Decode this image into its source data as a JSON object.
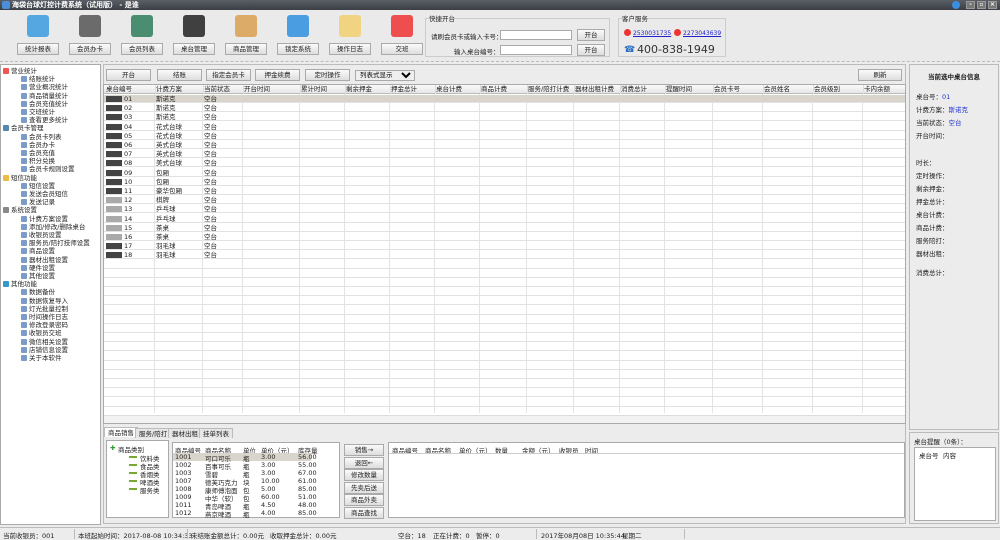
{
  "window": {
    "title": "海袋台球灯控计费系统（试用版） - 是谁"
  },
  "toolbar": {
    "items": [
      "统计报表",
      "会员办卡",
      "会员列表",
      "桌台管理",
      "商品管理",
      "锁定系统",
      "操作日志",
      "交班"
    ]
  },
  "quick_open": {
    "title": "快捷开台",
    "card_label": "请刷会员卡或输入卡号：",
    "card_value": "",
    "table_label": "输入桌台编号：",
    "table_value": "",
    "open_btn": "开台"
  },
  "service": {
    "title": "客户服务",
    "qq1": "2530031735",
    "qq2": "2273043639",
    "phone": "400-838-1949"
  },
  "sidebar": [
    {
      "label": "营业统计",
      "children": [
        "结账统计",
        "营业概况统计",
        "商品销量统计",
        "会员充值统计",
        "交班统计",
        "查看更多统计"
      ]
    },
    {
      "label": "会员卡管理",
      "children": [
        "会员卡列表",
        "会员办卡",
        "会员充值",
        "积分兑换",
        "会员卡规则设置"
      ]
    },
    {
      "label": "短信功能",
      "children": [
        "短信设置",
        "发送会员短信",
        "发送记录"
      ]
    },
    {
      "label": "系统设置",
      "children": [
        "计费方案设置",
        "添加/修改/删除桌台",
        "收银员设置",
        "服务员/陪打技师设置",
        "商品设置",
        "器材出租设置",
        "硬件设置",
        "其他设置"
      ]
    },
    {
      "label": "其他功能",
      "children": [
        "数据备份",
        "数据恢复导入",
        "灯光批量控制",
        "时间操作日志",
        "修改登录密码",
        "收银员交班",
        "微信相关设置",
        "店铺信息设置",
        "关于本软件"
      ]
    }
  ],
  "actions": {
    "buttons": [
      "开台",
      "结账",
      "指定会员卡",
      "押金续费",
      "定时操作"
    ],
    "view_select": "列表式显示",
    "refresh": "刷新"
  },
  "grid": {
    "columns": [
      "桌台编号",
      "计费方案",
      "当前状态",
      "开台时间",
      "累计时间",
      "剩余押金",
      "押金总计",
      "桌台计费",
      "商品计费",
      "服务/陪打计费",
      "器材出租计费",
      "消费总计",
      "提醒时间",
      "会员卡号",
      "会员姓名",
      "会员级别",
      "卡内余额"
    ],
    "rows": [
      [
        "01",
        "斯诺克",
        "空台"
      ],
      [
        "02",
        "斯诺克",
        "空台"
      ],
      [
        "03",
        "斯诺克",
        "空台"
      ],
      [
        "04",
        "花式台球",
        "空台"
      ],
      [
        "05",
        "花式台球",
        "空台"
      ],
      [
        "06",
        "英式台球",
        "空台"
      ],
      [
        "07",
        "英式台球",
        "空台"
      ],
      [
        "08",
        "美式台球",
        "空台"
      ],
      [
        "09",
        "包厢",
        "空台"
      ],
      [
        "10",
        "包厢",
        "空台"
      ],
      [
        "11",
        "豪华包厢",
        "空台"
      ],
      [
        "12",
        "棋牌",
        "空台"
      ],
      [
        "13",
        "乒乓球",
        "空台"
      ],
      [
        "14",
        "乒乓球",
        "空台"
      ],
      [
        "15",
        "茶桌",
        "空台"
      ],
      [
        "16",
        "茶桌",
        "空台"
      ],
      [
        "17",
        "羽毛球",
        "空台"
      ],
      [
        "18",
        "羽毛球",
        "空台"
      ]
    ]
  },
  "bottom_tabs": [
    "商品销售",
    "服务/陪打",
    "器材出租",
    "挂单列表"
  ],
  "categories": {
    "root": "商品类别",
    "items": [
      "饮料类",
      "食品类",
      "香烟类",
      "啤酒类",
      "服务类"
    ]
  },
  "products": {
    "columns": [
      "商品编号",
      "商品名称",
      "单位",
      "单价（元）",
      "库存量"
    ],
    "rows": [
      [
        "1001",
        "可口可乐",
        "瓶",
        "3.00",
        "56.00"
      ],
      [
        "1002",
        "百事可乐",
        "瓶",
        "3.00",
        "55.00"
      ],
      [
        "1003",
        "雪碧",
        "瓶",
        "3.00",
        "67.00"
      ],
      [
        "1007",
        "德芙巧克力",
        "块",
        "10.00",
        "61.00"
      ],
      [
        "1008",
        "康师傅泡面",
        "包",
        "5.00",
        "85.00"
      ],
      [
        "1009",
        "中华（软）",
        "包",
        "60.00",
        "51.00"
      ],
      [
        "1011",
        "青岛啤酒",
        "瓶",
        "4.50",
        "48.00"
      ],
      [
        "1012",
        "燕京啤酒",
        "瓶",
        "4.00",
        "85.00"
      ]
    ]
  },
  "product_actions": [
    "销售→",
    "退回←",
    "修改数量",
    "先卖后送",
    "商品外卖",
    "商品查找"
  ],
  "sales": {
    "columns": [
      "商品编号",
      "商品名称",
      "单价（元）",
      "数量",
      "金额（元）",
      "收银员",
      "时间"
    ]
  },
  "info": {
    "title": "当前选中桌台信息",
    "table_no_label": "桌台号：",
    "table_no": "01",
    "plan_label": "计费方案：",
    "plan": "斯诺克",
    "status_label": "当前状态：",
    "status": "空台",
    "fields": [
      "开台时间：",
      "时长：",
      "定时操作：",
      "剩余押金：",
      "押金总计：",
      "桌台计费：",
      "商品计费：",
      "服务陪打：",
      "器材出租：",
      "消费总计："
    ]
  },
  "reminder": {
    "title": "桌台提醒（0条）：",
    "columns": [
      "桌台号",
      "内容"
    ]
  },
  "status": {
    "cashier": "当前收银员：001",
    "shift_start": "本班起始时间：2017-08-08 10:34:33",
    "unsettled": "未结账金额总计：0.00元",
    "deposit": "收取押金总计：0.00元",
    "free": "空台：18",
    "billing": "正在计费：0",
    "paused": "暂停：0",
    "datetime": "2017年08月08日 10:35:44",
    "weekday": "星期二"
  }
}
